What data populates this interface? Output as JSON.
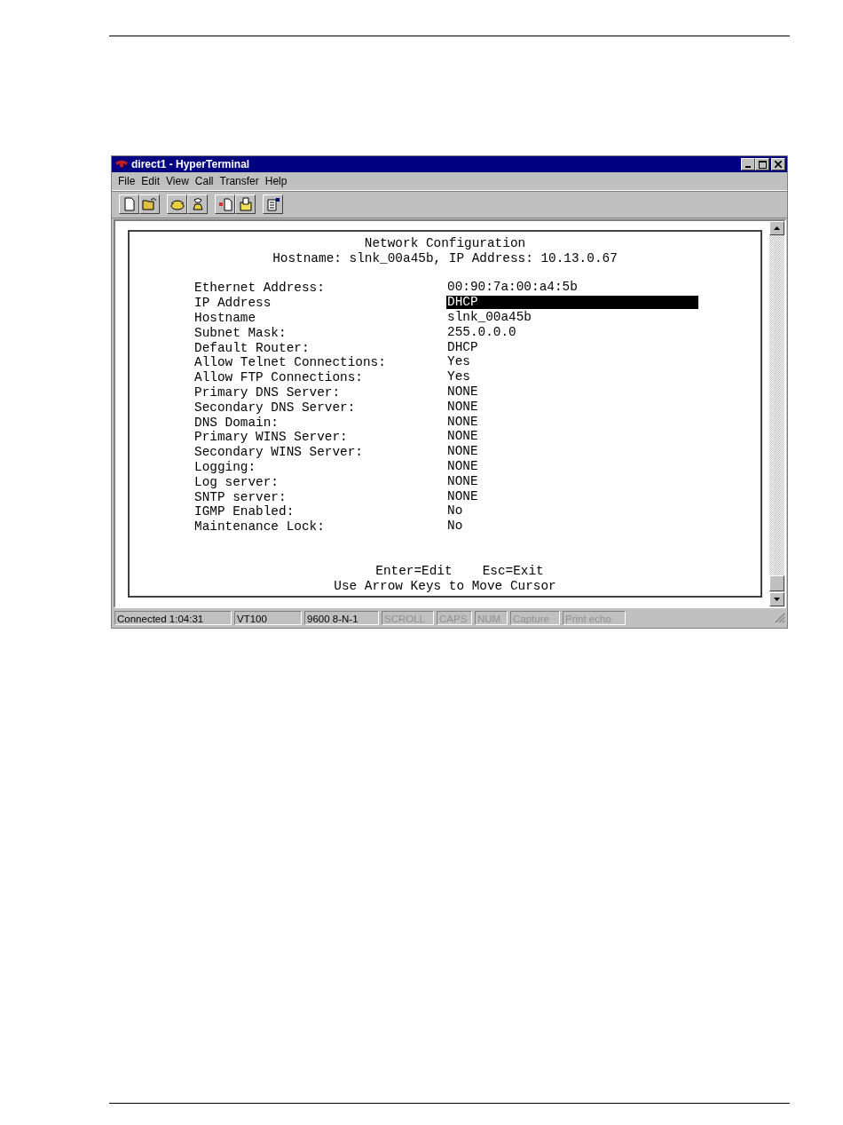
{
  "window": {
    "title": "direct1 - HyperTerminal"
  },
  "menu": [
    "File",
    "Edit",
    "View",
    "Call",
    "Transfer",
    "Help"
  ],
  "toolbar": [
    {
      "kind": "new"
    },
    {
      "kind": "open"
    },
    {
      "kind": "call"
    },
    {
      "kind": "hangup"
    },
    {
      "kind": "send"
    },
    {
      "kind": "receive"
    },
    {
      "kind": "properties"
    }
  ],
  "terminal": {
    "title": "Network Configuration",
    "subtitle": "Hostname: slnk_00a45b, IP Address: 10.13.0.67",
    "fields": [
      {
        "label": "Ethernet Address:",
        "value": "00:90:7a:00:a4:5b",
        "selected": false
      },
      {
        "label": "IP Address",
        "value": "DHCP",
        "selected": true
      },
      {
        "label": "Hostname",
        "value": "slnk_00a45b",
        "selected": false
      },
      {
        "label": "Subnet Mask:",
        "value": "255.0.0.0",
        "selected": false
      },
      {
        "label": "Default Router:",
        "value": "DHCP",
        "selected": false
      },
      {
        "label": "Allow Telnet Connections:",
        "value": "Yes",
        "selected": false
      },
      {
        "label": "Allow FTP Connections:",
        "value": "Yes",
        "selected": false
      },
      {
        "label": "Primary DNS Server:",
        "value": "NONE",
        "selected": false
      },
      {
        "label": "Secondary DNS Server:",
        "value": "NONE",
        "selected": false
      },
      {
        "label": "DNS Domain:",
        "value": "NONE",
        "selected": false
      },
      {
        "label": "Primary WINS Server:",
        "value": "NONE",
        "selected": false
      },
      {
        "label": "Secondary WINS Server:",
        "value": "NONE",
        "selected": false
      },
      {
        "label": "Logging:",
        "value": "NONE",
        "selected": false
      },
      {
        "label": "Log server:",
        "value": "NONE",
        "selected": false
      },
      {
        "label": "SNTP server:",
        "value": "NONE",
        "selected": false
      },
      {
        "label": "IGMP Enabled:",
        "value": "No",
        "selected": false
      },
      {
        "label": "Maintenance Lock:",
        "value": "No",
        "selected": false
      }
    ],
    "keys": [
      "Enter=Edit",
      "Esc=Exit"
    ],
    "hint": "Use Arrow Keys to Move Cursor"
  },
  "status_bar": [
    {
      "text": "Connected 1:04:31",
      "disabled": false
    },
    {
      "text": "VT100",
      "disabled": false
    },
    {
      "text": "9600 8-N-1",
      "disabled": false
    },
    {
      "text": "SCROLL",
      "disabled": true
    },
    {
      "text": "CAPS",
      "disabled": true
    },
    {
      "text": "NUM",
      "disabled": true
    },
    {
      "text": "Capture",
      "disabled": true
    },
    {
      "text": "Print echo",
      "disabled": true
    }
  ]
}
